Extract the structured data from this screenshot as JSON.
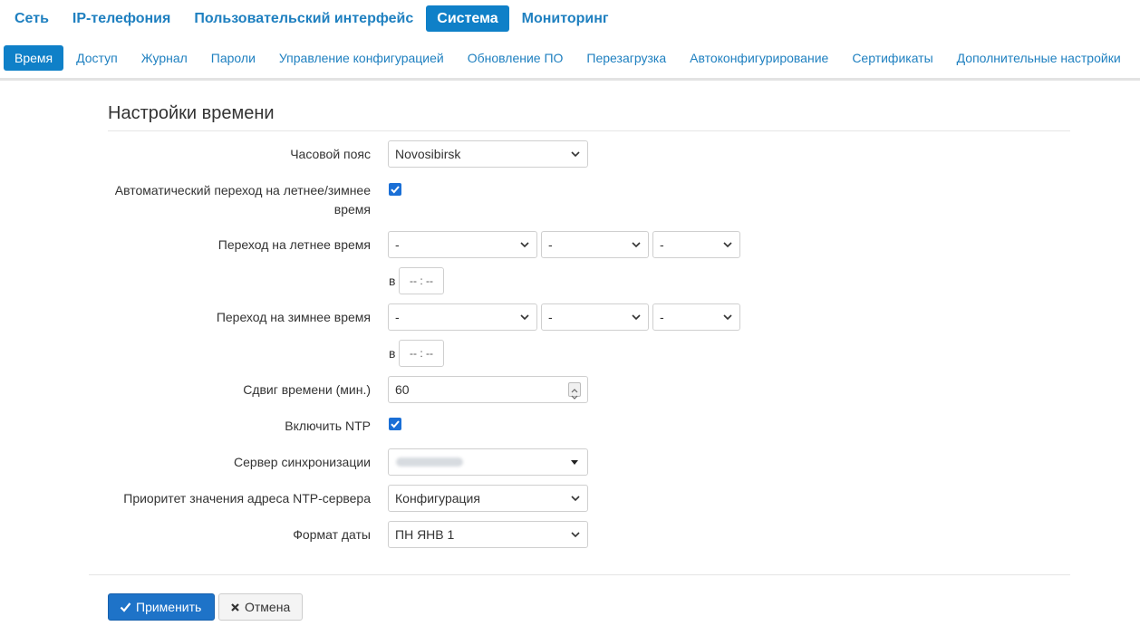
{
  "top_nav": {
    "items": [
      {
        "label": "Сеть"
      },
      {
        "label": "IP-телефония"
      },
      {
        "label": "Пользовательский интерфейс"
      },
      {
        "label": "Система",
        "active": true
      },
      {
        "label": "Мониторинг"
      }
    ]
  },
  "sub_nav": {
    "items": [
      {
        "label": "Время",
        "active": true
      },
      {
        "label": "Доступ"
      },
      {
        "label": "Журнал"
      },
      {
        "label": "Пароли"
      },
      {
        "label": "Управление конфигурацией"
      },
      {
        "label": "Обновление ПО"
      },
      {
        "label": "Перезагрузка"
      },
      {
        "label": "Автоконфигурирование"
      },
      {
        "label": "Сертификаты"
      },
      {
        "label": "Дополнительные настройки"
      }
    ]
  },
  "section": {
    "title": "Настройки времени"
  },
  "fields": {
    "timezone": {
      "label": "Часовой пояс",
      "value": "Novosibirsk"
    },
    "auto_dst": {
      "label_line1": "Автоматический переход на летнее/зимнее",
      "label_line2": "время",
      "checked": true
    },
    "dst_start": {
      "label": "Переход на летнее время",
      "values": [
        "-",
        "-",
        "-"
      ],
      "at_label": "в",
      "time_placeholder": "-- : --"
    },
    "dst_end": {
      "label": "Переход на зимнее время",
      "values": [
        "-",
        "-",
        "-"
      ],
      "at_label": "в",
      "time_placeholder": "-- : --"
    },
    "shift": {
      "label": "Сдвиг времени (мин.)",
      "value": "60"
    },
    "ntp_enable": {
      "label": "Включить NTP",
      "checked": true
    },
    "ntp_server": {
      "label": "Сервер синхронизации"
    },
    "ntp_priority": {
      "label": "Приоритет значения адреса NTP-сервера",
      "value": "Конфигурация"
    },
    "date_format": {
      "label": "Формат даты",
      "value": "ПН ЯНВ 1"
    }
  },
  "buttons": {
    "apply": "Применить",
    "cancel": "Отмена"
  },
  "colors": {
    "accent": "#0f80c8",
    "link": "#1f80c0",
    "primary_button": "#1e73c8",
    "checkbox": "#1a6fd6"
  }
}
